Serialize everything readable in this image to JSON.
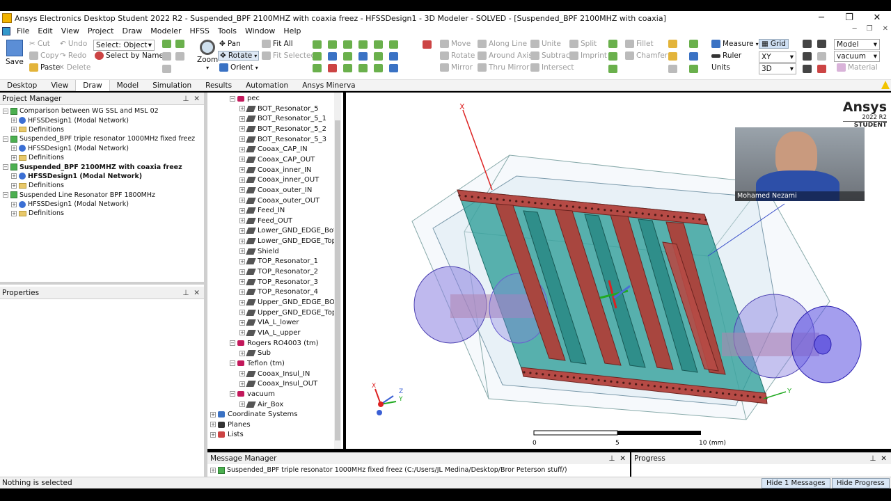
{
  "window": {
    "title": "Ansys Electronics Desktop Student 2022 R2 - Suspended_BPF 2100MHZ  with coaxia freez - HFSSDesign1 - 3D Modeler - SOLVED - [Suspended_BPF 2100MHZ  with coaxia]"
  },
  "menu": [
    "File",
    "Edit",
    "View",
    "Project",
    "Draw",
    "Modeler",
    "HFSS",
    "Tools",
    "Window",
    "Help"
  ],
  "ribbon": {
    "save": "Save",
    "cut": "Cut",
    "copy": "Copy",
    "paste": "Paste",
    "undo": "Undo",
    "redo": "Redo",
    "delete": "Delete",
    "select_object": "Select: Object",
    "select_by_name": "Select by Name",
    "pan": "Pan",
    "rotate": "Rotate",
    "orient": "Orient",
    "zoom": "Zoom",
    "fit_all": "Fit All",
    "fit_selected": "Fit Selected",
    "move": "Move",
    "rotate2": "Rotate",
    "mirror": "Mirror",
    "along_line": "Along Line",
    "around_axis": "Around Axis",
    "thru_mirror": "Thru Mirror",
    "unite": "Unite",
    "subtract": "Subtract",
    "intersect": "Intersect",
    "split": "Split",
    "imprint": "Imprint",
    "fillet": "Fillet",
    "chamfer": "Chamfer",
    "measure": "Measure",
    "ruler": "Ruler",
    "units": "Units",
    "grid": "Grid",
    "plane": "XY",
    "view3d": "3D",
    "model": "Model",
    "vacuum": "vacuum",
    "material": "Material"
  },
  "tabs": [
    "Desktop",
    "View",
    "Draw",
    "Model",
    "Simulation",
    "Results",
    "Automation",
    "Ansys Minerva"
  ],
  "project_manager": {
    "title": "Project Manager",
    "items": [
      {
        "label": "Comparison between WG SSL and MSL 02",
        "design": "HFSSDesign1 (Modal Network)",
        "defs": "Definitions",
        "bold": false
      },
      {
        "label": "Suspended_BPF  triple resonator 1000MHz  fixed freez",
        "design": "HFSSDesign1 (Modal Network)",
        "defs": "Definitions",
        "bold": false
      },
      {
        "label": "Suspended_BPF 2100MHZ  with coaxia freez",
        "design": "HFSSDesign1 (Modal Network)",
        "defs": "Definitions",
        "bold": true
      },
      {
        "label": "Suspended Line Resonator BPF 1800MHz",
        "design": "HFSSDesign1 (Modal Network)",
        "defs": "Definitions",
        "bold": false
      }
    ]
  },
  "properties": {
    "title": "Properties"
  },
  "model_tree": {
    "mat_pec": "pec",
    "pec_items": [
      "BOT_Resonator_5",
      "BOT_Resonator_5_1",
      "BOT_Resonator_5_2",
      "BOT_Resonator_5_3",
      "Cooax_CAP_IN",
      "Cooax_CAP_OUT",
      "Cooax_inner_IN",
      "Cooax_inner_OUT",
      "Cooax_outer_IN",
      "Cooax_outer_OUT",
      "Feed_IN",
      "Feed_OUT",
      "Lower_GND_EDGE_Bot",
      "Lower_GND_EDGE_Top",
      "Shield",
      "TOP_Resonator_1",
      "TOP_Resonator_2",
      "TOP_Resonator_3",
      "TOP_Resonator_4",
      "Upper_GND_EDGE_BOT",
      "Upper_GND_EDGE_Top",
      "VIA_L_lower",
      "VIA_L_upper"
    ],
    "mat_rogers": "Rogers RO4003 (tm)",
    "rogers_item": "Sub",
    "mat_teflon": "Teflon (tm)",
    "teflon_items": [
      "Cooax_Insul_IN",
      "Cooax_Insul_OUT"
    ],
    "mat_vacuum": "vacuum",
    "vacuum_item": "Air_Box",
    "coord": "Coordinate Systems",
    "planes": "Planes",
    "lists": "Lists"
  },
  "viewport": {
    "brand": "Ansys",
    "version": "2022 R2",
    "edition": "STUDENT",
    "webcam_name": "Mohamed Nezami",
    "scale_0": "0",
    "scale_5": "5",
    "scale_10": "10 (mm)",
    "axis_x": "X",
    "axis_y": "Y",
    "axis_z": "Z"
  },
  "message_manager": {
    "title": "Message Manager",
    "message": "Suspended_BPF  triple resonator 1000MHz  fixed freez (C:/Users/JL Medina/Desktop/Bror Peterson stuff/)"
  },
  "progress": {
    "title": "Progress"
  },
  "status": {
    "text": "Nothing is selected",
    "hide_messages": "Hide 1 Messages",
    "hide_progress": "Hide Progress"
  }
}
